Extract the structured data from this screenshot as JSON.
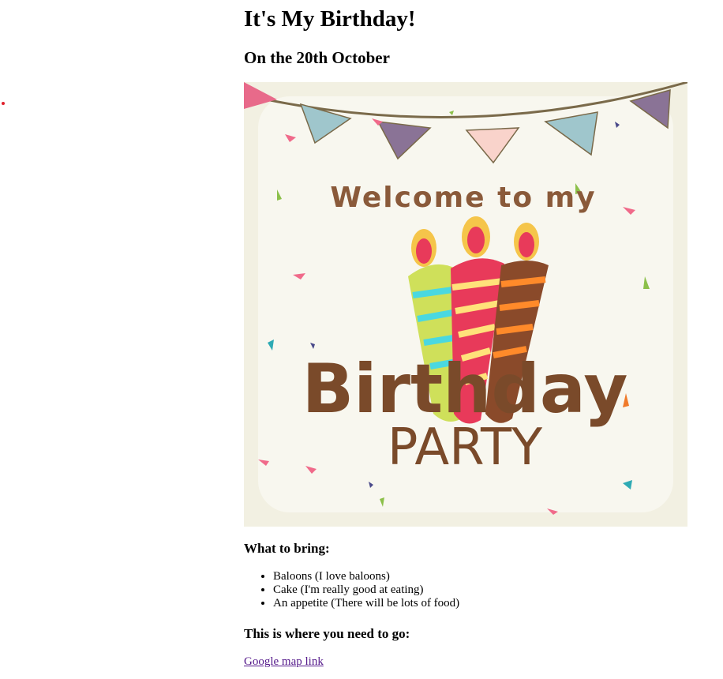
{
  "page": {
    "title": "It's My Birthday!",
    "subtitle": "On the 20th October"
  },
  "poster": {
    "line1": "Welcome to my",
    "line2": "Birthday",
    "line3": "PARTY"
  },
  "bring": {
    "heading": "What to bring:",
    "items": [
      "Baloons (I love baloons)",
      "Cake (I'm really good at eating)",
      "An appetite (There will be lots of food)"
    ]
  },
  "location": {
    "heading": "This is where you need to go:",
    "link_label": "Google map link"
  },
  "colors": {
    "poster_bg": "#f2f0e2",
    "link": "#551a8b"
  }
}
